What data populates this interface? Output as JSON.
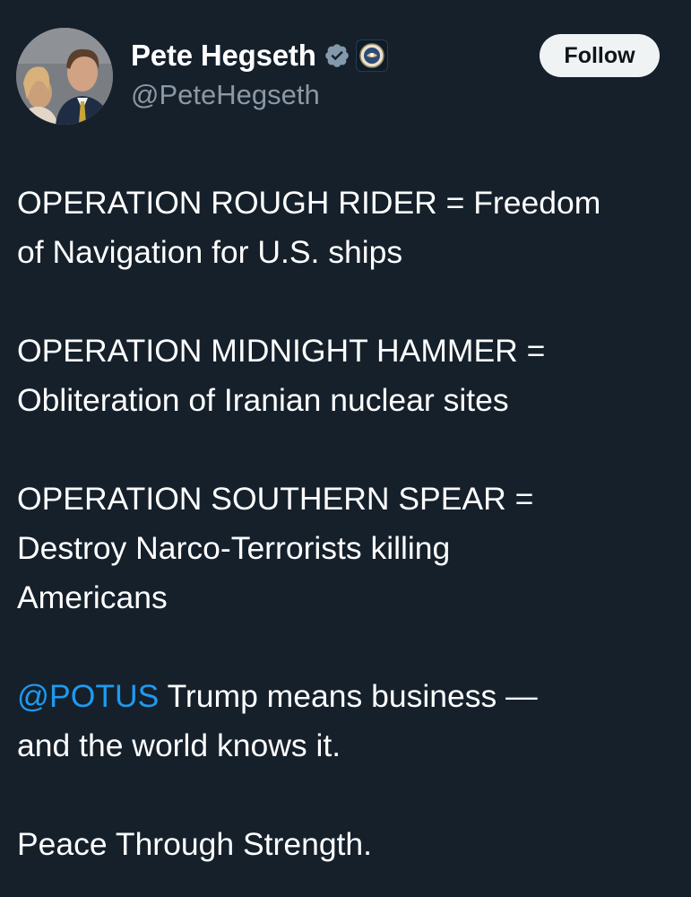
{
  "user": {
    "display_name": "Pete Hegseth",
    "handle": "@PeteHegseth",
    "verified_badge": "verified-checkmark-icon",
    "affiliation_badge": "department-seal-icon"
  },
  "follow_button": {
    "label": "Follow"
  },
  "tweet": {
    "paragraphs": [
      {
        "lines": [
          "OPERATION ROUGH RIDER = Freedom",
          "of Navigation for U.S. ships"
        ]
      },
      {
        "lines": [
          "OPERATION MIDNIGHT HAMMER =",
          "Obliteration of Iranian nuclear sites"
        ]
      },
      {
        "lines": [
          "OPERATION SOUTHERN SPEAR =",
          "Destroy Narco-Terrorists killing",
          "Americans"
        ]
      },
      {
        "mention": "@POTUS",
        "line1_rest": " Trump means business —",
        "line2": "and the world knows it."
      },
      {
        "lines": [
          "Peace Through Strength."
        ]
      }
    ]
  },
  "colors": {
    "background": "#15202b",
    "text": "#ffffff",
    "secondary_text": "#8b98a5",
    "link": "#1d9bf0",
    "follow_bg": "#eff3f4"
  }
}
